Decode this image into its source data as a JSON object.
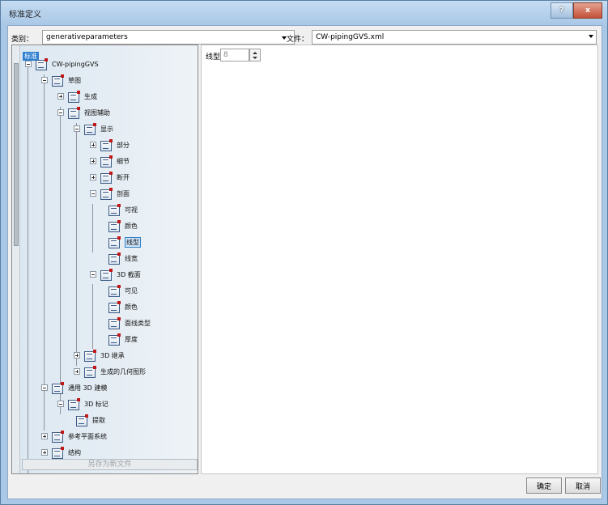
{
  "window": {
    "title": "标准定义",
    "help_label": "?",
    "close_label": "x"
  },
  "top": {
    "category_label": "类别：",
    "category_value": "generativeparameters",
    "file_label": "文件：",
    "file_value": "CW-pipingGVS.xml"
  },
  "tree": {
    "root_label": "标准",
    "items": [
      "CW-pipingGVS",
      "草图",
      "生成",
      "视图辅助",
      "显示",
      "部分",
      "细节",
      "断开",
      "剖面",
      "可视",
      "颜色",
      "线型",
      "线宽",
      "3D 截面",
      "可见",
      "颜色",
      "面线类型",
      "厚度",
      "3D 继承",
      "生成的几何图形",
      "通用 3D 建模",
      "3D 标记",
      "提取",
      "参考平面系统",
      "结构"
    ],
    "selected_index": 11,
    "save_as_label": "另存为新文件"
  },
  "props": {
    "linetype_label": "线型",
    "linetype_value": "8"
  },
  "buttons": {
    "ok": "确定",
    "cancel": "取消"
  }
}
